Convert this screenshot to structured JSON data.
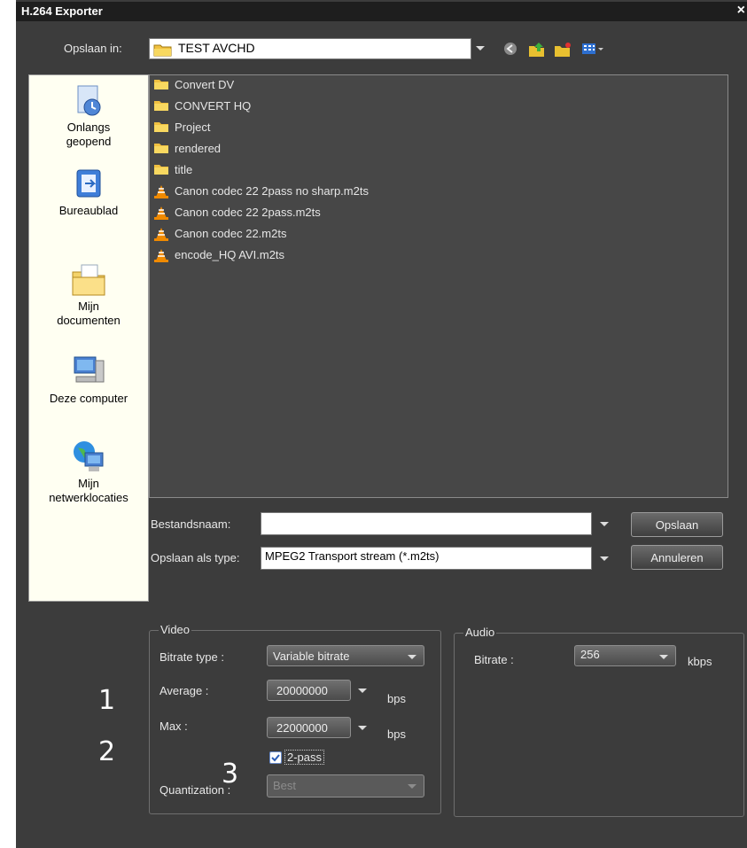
{
  "window": {
    "title": "H.264 Exporter",
    "close_glyph": "×"
  },
  "lookin": {
    "label": "Opslaan in:",
    "value": "TEST AVCHD"
  },
  "places": [
    {
      "label_1": "Onlangs",
      "label_2": "geopend"
    },
    {
      "label_1": "Bureaublad",
      "label_2": ""
    },
    {
      "label_1": "Mijn",
      "label_2": "documenten"
    },
    {
      "label_1": "Deze computer",
      "label_2": ""
    },
    {
      "label_1": "Mijn",
      "label_2": "netwerklocaties"
    }
  ],
  "files": [
    {
      "name": "Convert DV",
      "kind": "folder"
    },
    {
      "name": "CONVERT HQ",
      "kind": "folder"
    },
    {
      "name": "Project",
      "kind": "folder"
    },
    {
      "name": "rendered",
      "kind": "folder"
    },
    {
      "name": "title",
      "kind": "folder"
    },
    {
      "name": "Canon codec 22 2pass no sharp.m2ts",
      "kind": "vlc-file"
    },
    {
      "name": "Canon codec 22 2pass.m2ts",
      "kind": "vlc-file"
    },
    {
      "name": "Canon codec 22.m2ts",
      "kind": "vlc-file"
    },
    {
      "name": "encode_HQ AVI.m2ts",
      "kind": "vlc-file"
    }
  ],
  "filename": {
    "label": "Bestandsnaam:",
    "value": ""
  },
  "filetype": {
    "label": "Opslaan als type:",
    "value": "MPEG2 Transport stream (*.m2ts)"
  },
  "buttons": {
    "save": "Opslaan",
    "cancel": "Annuleren"
  },
  "video": {
    "legend": "Video",
    "bitrate_type_label": "Bitrate type :",
    "bitrate_type_value": "Variable bitrate",
    "average_label": "Average :",
    "average_value": "20000000",
    "average_unit": "bps",
    "max_label": "Max :",
    "max_value": "22000000",
    "max_unit": "bps",
    "twopass_label": "2-pass",
    "twopass_checked": true,
    "quantization_label": "Quantization :",
    "quantization_value": "Best"
  },
  "audio": {
    "legend": "Audio",
    "bitrate_label": "Bitrate :",
    "bitrate_value": "256",
    "bitrate_unit": "kbps"
  },
  "annotations": [
    "1",
    "2",
    "3"
  ],
  "colors": {
    "background": "#3c3c3c",
    "places_panel": "#fffff2",
    "file_list": "#474747",
    "titlebar": "#1e1e1e"
  }
}
